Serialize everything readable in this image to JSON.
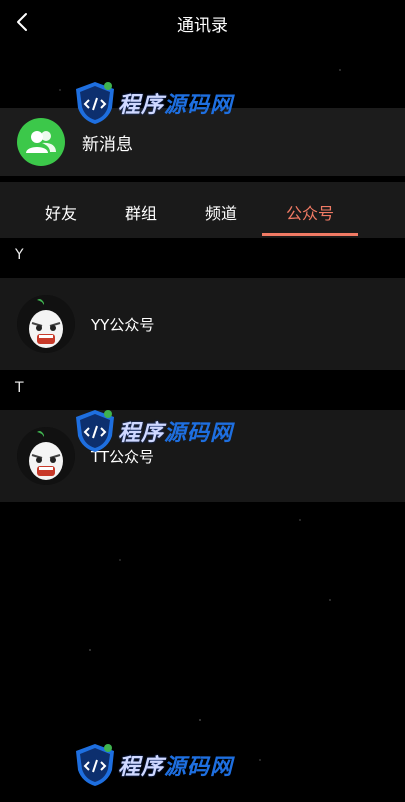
{
  "header": {
    "title": "通讯录",
    "back_icon": "chevron-left-icon"
  },
  "new_messages": {
    "label": "新消息",
    "icon": "contacts-icon",
    "icon_color": "#3cc84a"
  },
  "tabs": {
    "items": [
      {
        "label": "好友"
      },
      {
        "label": "群组"
      },
      {
        "label": "频道"
      },
      {
        "label": "公众号"
      }
    ],
    "active_index": 3,
    "active_color": "#f07a64"
  },
  "sections": [
    {
      "letter": "Y",
      "items": [
        {
          "name": "YY公众号"
        }
      ]
    },
    {
      "letter": "T",
      "items": [
        {
          "name": "TT公众号"
        }
      ]
    }
  ],
  "watermark": {
    "part1": "程序",
    "part2": "源码网"
  }
}
